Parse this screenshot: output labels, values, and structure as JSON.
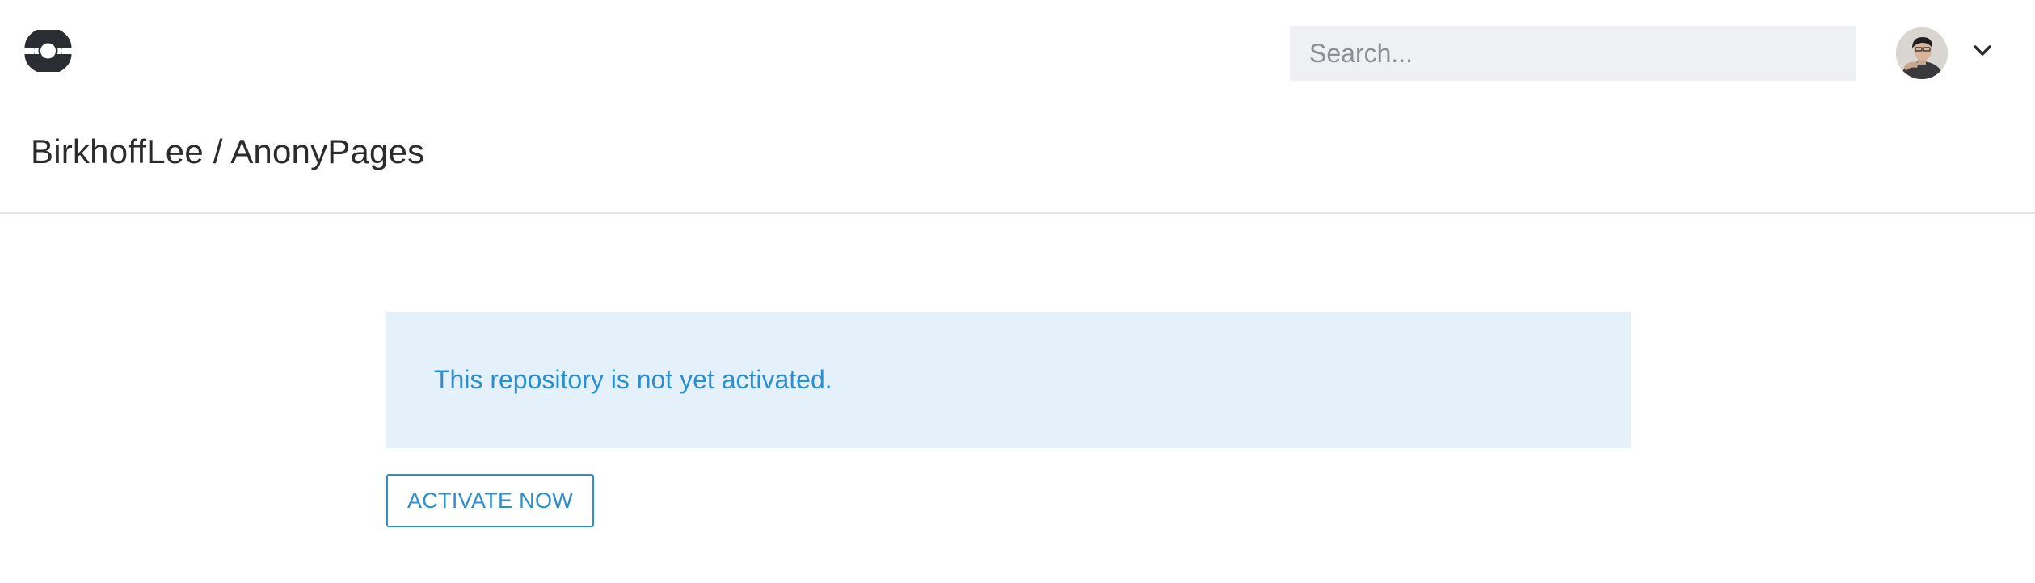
{
  "header": {
    "logo_icon": "drone-logo-icon",
    "search": {
      "placeholder": "Search...",
      "value": ""
    },
    "user": {
      "avatar_icon": "user-avatar",
      "menu_icon": "chevron-down-icon"
    }
  },
  "repo": {
    "title": "BirkhoffLee / AnonyPages"
  },
  "notice": {
    "message": "This repository is not yet activated.",
    "button_label": "ACTIVATE NOW"
  },
  "colors": {
    "accent": "#2a8fd1",
    "alert_background": "#e5f1fa",
    "search_background": "#eef0f3",
    "logo": "#2b2d33"
  }
}
